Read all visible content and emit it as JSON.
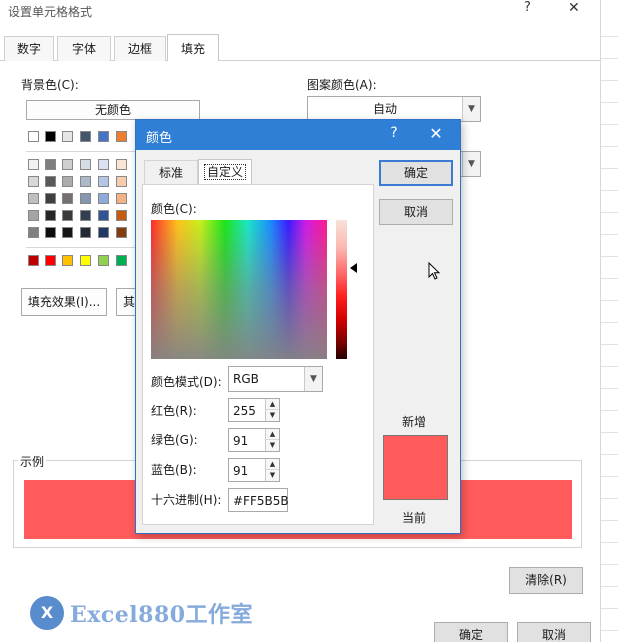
{
  "outer_dialog": {
    "title": "设置单元格格式",
    "help_glyph": "?",
    "close_glyph": "✕",
    "tabs": [
      "数字",
      "字体",
      "边框",
      "填充"
    ],
    "active_tab": "填充",
    "background_color_label": "背景色(C):",
    "no_color_label": "无颜色",
    "pattern_color_label": "图案颜色(A):",
    "pattern_color_value": "自动",
    "fill_effects_label": "填充效果(I)...",
    "more_colors_partial": "其",
    "sample_label": "示例",
    "sample_color": "#ff5b5b",
    "clear_label": "清除(R)",
    "ok_label": "确定",
    "cancel_label": "取消"
  },
  "palette": {
    "row0": [
      "#ffffff",
      "#000000",
      "#e7e6e6",
      "#44546a",
      "#4472c4",
      "#ed7d31"
    ],
    "theme_rows": [
      [
        "#f2f2f2",
        "#7f7f7f",
        "#d0cece",
        "#d6dce4",
        "#d9e2f3",
        "#fbe5d5"
      ],
      [
        "#d8d8d8",
        "#595959",
        "#aeabab",
        "#adb9ca",
        "#b4c6e7",
        "#f7cbac"
      ],
      [
        "#bfbfbf",
        "#3f3f3f",
        "#757070",
        "#8496b0",
        "#8eaadb",
        "#f4b183"
      ],
      [
        "#a5a5a5",
        "#262626",
        "#3a3838",
        "#323f4f",
        "#2f5496",
        "#c55a11"
      ],
      [
        "#7f7f7f",
        "#0c0c0c",
        "#171616",
        "#222a35",
        "#1f3864",
        "#833c0b"
      ]
    ],
    "standard_row": [
      "#c00000",
      "#ff0000",
      "#ffc000",
      "#ffff00",
      "#92d050",
      "#00b050"
    ]
  },
  "color_dialog": {
    "title": "颜色",
    "help_glyph": "?",
    "close_glyph": "✕",
    "tabs": [
      "标准",
      "自定义"
    ],
    "active_tab": "自定义",
    "colors_label": "颜色(C):",
    "model_label": "颜色模式(D):",
    "model_value": "RGB",
    "red_label": "红色(R):",
    "red_value": "255",
    "green_label": "绿色(G):",
    "green_value": "91",
    "blue_label": "蓝色(B):",
    "blue_value": "91",
    "hex_label": "十六进制(H):",
    "hex_value": "#FF5B5B",
    "ok_label": "确定",
    "cancel_label": "取消",
    "new_label": "新增",
    "current_label": "当前",
    "new_color": "#ff5b5b",
    "current_color": "#ff5b5b"
  },
  "watermark": {
    "logo_text": "X",
    "text": "Excel880工作室"
  }
}
